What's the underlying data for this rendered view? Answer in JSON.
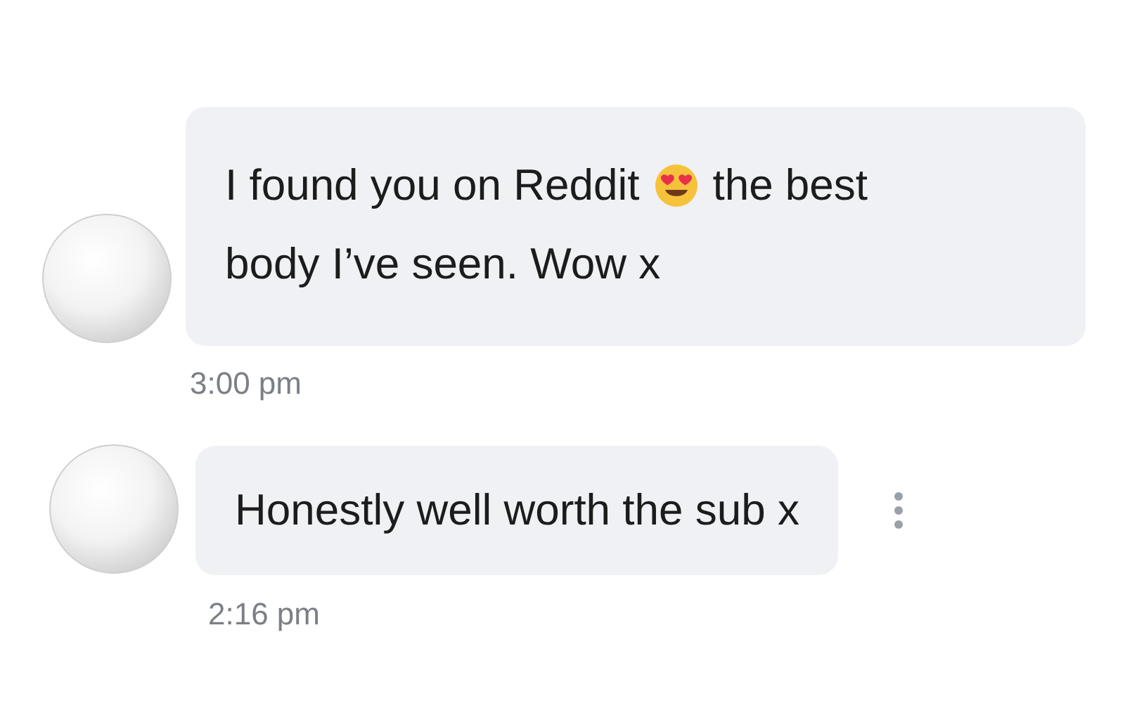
{
  "messages": [
    {
      "lines": [
        [
          {
            "kind": "text",
            "text": "I found you on Reddit"
          },
          {
            "kind": "emoji"
          },
          {
            "kind": "text",
            "text": "the best"
          }
        ],
        [
          {
            "kind": "text",
            "text": "body I’ve seen. Wow x"
          }
        ]
      ],
      "time": "3:00 pm",
      "menu": false
    },
    {
      "lines": [
        [
          {
            "kind": "text",
            "text": "Honestly well worth the sub x"
          }
        ]
      ],
      "time": "2:16 pm",
      "menu": true
    }
  ]
}
